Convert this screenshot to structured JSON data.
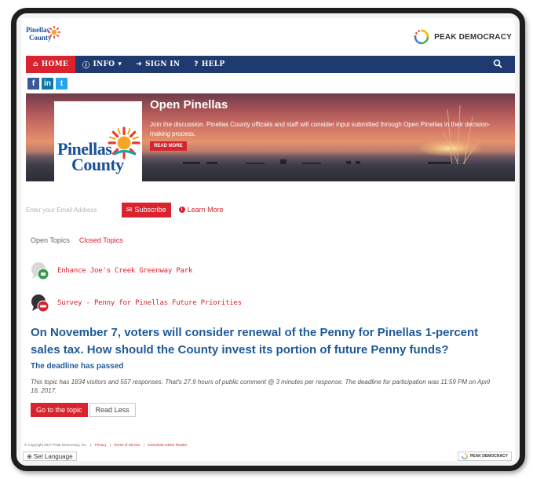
{
  "header": {
    "logo_line1": "Pinellas",
    "logo_line2": "County",
    "brand_text": "PEAK DEMOCRACY"
  },
  "nav": {
    "home": "HOME",
    "info": "INFO",
    "sign_in": "SIGN IN",
    "help": "HELP",
    "icons": [
      "home-icon",
      "info-icon",
      "sign-in-icon",
      "help-icon",
      "search-icon"
    ]
  },
  "social": {
    "facebook": "f",
    "linkedin": "in",
    "twitter": "t"
  },
  "hero": {
    "logo_line1": "Pinellas",
    "logo_line2": "County",
    "title": "Open Pinellas",
    "description": "Join the discussion. Pinellas County officials and staff will consider input submitted through Open Pinellas in their decision-making process.",
    "read_more": "READ MORE"
  },
  "subscribe": {
    "email_placeholder": "Enter your Email Address",
    "button_label": "Subscribe",
    "learn_more": "Learn More"
  },
  "tabs": {
    "open": "Open Topics",
    "closed": "Closed Topics"
  },
  "topics": [
    {
      "title": "Enhance Joe's Creek Greenway Park",
      "badge_color": "#3a9a4a"
    },
    {
      "title": "Survey - Penny for Pinellas Future Priorities",
      "badge_color": "#d9232e"
    }
  ],
  "featured": {
    "question": "On November 7, voters will consider renewal of the Penny for Pinellas 1-percent sales tax. How should the County invest its portion of future Penny funds?",
    "deadline_heading": "The deadline has passed",
    "stats": "This topic has 1834 visitors and 557 responses. That's 27.9 hours of public comment @ 3 minutes per response. The deadline for participation was 11:59 PM on April 16, 2017.",
    "goto_label": "Go to the topic",
    "read_less_label": "Read Less"
  },
  "footer": {
    "copyright": "© Copyright 2017 Peak Democracy, Inc.",
    "privacy": "Privacy",
    "terms": "Terms of Service",
    "adobe": "Download Adobe Reader",
    "set_language": "Set Language",
    "brand": "PEAK DEMOCRACY"
  },
  "colors": {
    "accent": "#d9232e",
    "navbar": "#1f3a6e",
    "heading_blue": "#1e5a9a"
  }
}
